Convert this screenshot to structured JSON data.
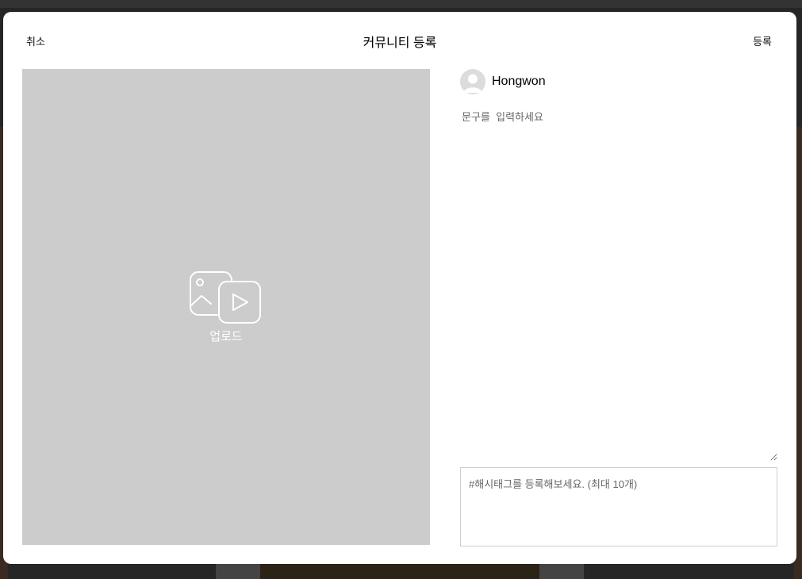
{
  "header": {
    "cancel_label": "취소",
    "title": "커뮤니티 등록",
    "submit_label": "등록"
  },
  "media": {
    "upload_label": "업로드",
    "icon": "image-video-upload-icon"
  },
  "profile": {
    "username": "Hongwon",
    "avatar_icon": "default-avatar-icon"
  },
  "caption": {
    "value": "",
    "placeholder": "문구를  입력하세요"
  },
  "hashtag": {
    "value": "",
    "placeholder": "#해시태그를 등록해보세요. (최대 10개)"
  },
  "colors": {
    "media_bg": "#cccccc",
    "modal_bg": "#ffffff",
    "overlay_bg": "#262626"
  }
}
